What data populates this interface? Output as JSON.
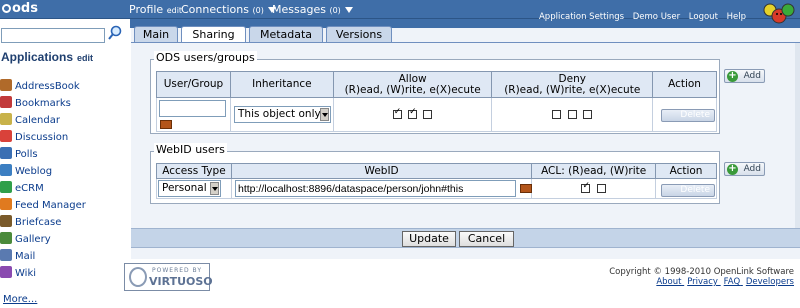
{
  "topbar": {
    "logo_text": "ods",
    "profile_label": "Profile",
    "profile_edit": "edit",
    "connections_label": "Connections",
    "connections_count": "(0)",
    "messages_label": "Messages",
    "messages_count": "(0)",
    "links": [
      "Application Settings",
      "Demo User",
      "Logout",
      "Help"
    ]
  },
  "sidebar": {
    "search_placeholder": "",
    "title": "Applications",
    "edit_label": "edit",
    "items": [
      {
        "label": "AddressBook",
        "icon": "addressbook-icon",
        "color": "#b06a2a"
      },
      {
        "label": "Bookmarks",
        "icon": "bookmarks-icon",
        "color": "#c23a3a"
      },
      {
        "label": "Calendar",
        "icon": "calendar-icon",
        "color": "#c8b24a"
      },
      {
        "label": "Discussion",
        "icon": "discussion-icon",
        "color": "#d9423a"
      },
      {
        "label": "Polls",
        "icon": "polls-icon",
        "color": "#3b6fb3"
      },
      {
        "label": "Weblog",
        "icon": "weblog-icon",
        "color": "#3c7fc2"
      },
      {
        "label": "eCRM",
        "icon": "ecrm-icon",
        "color": "#2f9f4a"
      },
      {
        "label": "Feed Manager",
        "icon": "feed-manager-icon",
        "color": "#e07a1f"
      },
      {
        "label": "Briefcase",
        "icon": "briefcase-icon",
        "color": "#7a5a2a"
      },
      {
        "label": "Gallery",
        "icon": "gallery-icon",
        "color": "#4a8a3a"
      },
      {
        "label": "Mail",
        "icon": "mail-icon",
        "color": "#5a7ab0"
      },
      {
        "label": "Wiki",
        "icon": "wiki-icon",
        "color": "#8a4ab0"
      }
    ],
    "more_label": "More..."
  },
  "tabs": [
    "Main",
    "Sharing",
    "Metadata",
    "Versions"
  ],
  "active_tab": "Sharing",
  "ods_section": {
    "legend": "ODS users/groups",
    "headers": {
      "user_group": "User/Group",
      "inheritance": "Inheritance",
      "allow_line1": "Allow",
      "allow_line2": "(R)ead, (W)rite, e(X)ecute",
      "deny_line1": "Deny",
      "deny_line2": "(R)ead, (W)rite, e(X)ecute",
      "action": "Action"
    },
    "row": {
      "user_value": "",
      "inheritance_value": "This object only",
      "allow": [
        true,
        true,
        false
      ],
      "deny": [
        false,
        false,
        false
      ],
      "delete_label": "Delete"
    },
    "add_label": "Add"
  },
  "webid_section": {
    "legend": "WebID users",
    "headers": {
      "access_type": "Access Type",
      "webid": "WebID",
      "acl": "ACL: (R)ead, (W)rite",
      "action": "Action"
    },
    "row": {
      "access_type_value": "Personal",
      "webid_value": "http://localhost:8896/dataspace/person/john#this",
      "acl": [
        true,
        false
      ],
      "delete_label": "Delete"
    },
    "add_label": "Add"
  },
  "actions": {
    "update_label": "Update",
    "cancel_label": "Cancel"
  },
  "footer": {
    "powered_by": "POWERED BY",
    "virtuoso": "VIRTUOSO",
    "copyright": "Copyright © 1998-2010 OpenLink Software",
    "links": [
      "About",
      "Privacy",
      "FAQ",
      "Developers"
    ]
  }
}
